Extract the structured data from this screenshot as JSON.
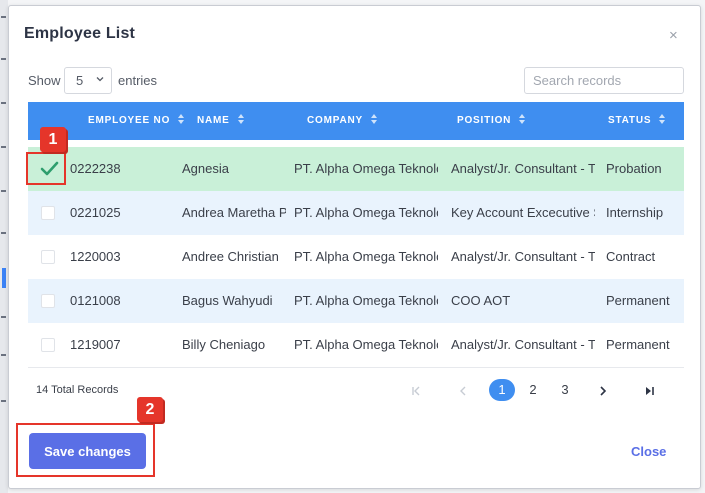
{
  "modal": {
    "title": "Employee List",
    "close_icon": "×"
  },
  "controls": {
    "show_label": "Show",
    "entries_value": "5",
    "entries_label": "entries",
    "search_placeholder": "Search records"
  },
  "table": {
    "columns": [
      "EMPLOYEE NO",
      "NAME",
      "COMPANY",
      "POSITION",
      "STATUS"
    ],
    "rows": [
      {
        "checked": true,
        "employee_no": "0222238",
        "name": "Agnesia",
        "company": "PT. Alpha Omega Teknologi",
        "position": "Analyst/Jr. Consultant - Technical",
        "status": "Probation"
      },
      {
        "checked": false,
        "employee_no": "0221025",
        "name": "Andrea Maretha Putri",
        "company": "PT. Alpha Omega Teknologi",
        "position": "Key Account Excecutive Sales",
        "status": "Internship"
      },
      {
        "checked": false,
        "employee_no": "1220003",
        "name": "Andree Christian",
        "company": "PT. Alpha Omega Teknologi",
        "position": "Analyst/Jr. Consultant - Technical",
        "status": "Contract"
      },
      {
        "checked": false,
        "employee_no": "0121008",
        "name": "Bagus Wahyudi",
        "company": "PT. Alpha Omega Teknologi",
        "position": "COO AOT",
        "status": "Permanent"
      },
      {
        "checked": false,
        "employee_no": "1219007",
        "name": "Billy Cheniago",
        "company": "PT. Alpha Omega Teknologi",
        "position": "Analyst/Jr. Consultant - Technical",
        "status": "Permanent"
      }
    ]
  },
  "footer": {
    "total_records": "14 Total Records",
    "pages": [
      "1",
      "2",
      "3"
    ],
    "active_page": "1",
    "first_icon": "first-page-icon",
    "prev_icon": "prev-page-icon",
    "next_icon": "next-page-icon",
    "last_icon": "last-page-icon"
  },
  "actions": {
    "save_label": "Save changes",
    "close_label": "Close"
  },
  "annotations": {
    "step1": "1",
    "step2": "2"
  },
  "colors": {
    "header_blue": "#3f8ef0",
    "selected_row": "#c9f0d8",
    "striped_row": "#e9f3fd",
    "save_button": "#5a6fe6",
    "annotation_red": "#e5352a"
  }
}
